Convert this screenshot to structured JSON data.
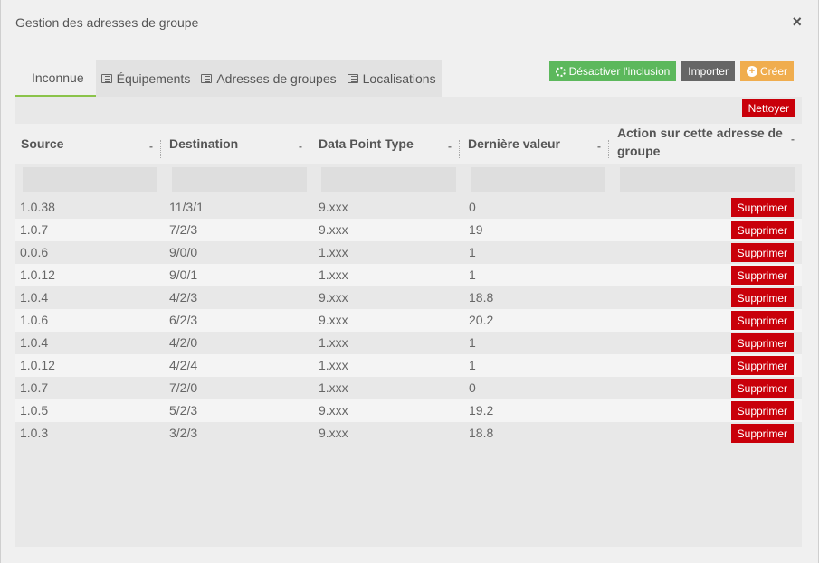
{
  "modal": {
    "title": "Gestion des adresses de groupe",
    "close_glyph": "×"
  },
  "tabs": [
    {
      "label": "Inconnue",
      "icon": null
    },
    {
      "label": "Équipements",
      "icon": "list-icon"
    },
    {
      "label": "Adresses de groupes",
      "icon": "list-icon"
    },
    {
      "label": "Localisations",
      "icon": "list-icon"
    }
  ],
  "toolbar": {
    "disable_inclusion": "Désactiver l'inclusion",
    "import": "Importer",
    "create": "Créer",
    "create_glyph": "+"
  },
  "colors": {
    "green": "#5cb85c",
    "gray": "#666666",
    "orange": "#f0ad4e",
    "red": "#c9000a",
    "active_tab_underline": "#8bc34a"
  },
  "table": {
    "clean_button": "Nettoyer",
    "columns": [
      {
        "label": "Source",
        "sort": "-"
      },
      {
        "label": "Destination",
        "sort": "-"
      },
      {
        "label": "Data Point Type",
        "sort": "-"
      },
      {
        "label": "Dernière valeur",
        "sort": "-"
      },
      {
        "label": "Action sur cette adresse de groupe",
        "sort": "-"
      }
    ],
    "delete_label": "Supprimer",
    "rows": [
      {
        "source": "1.0.38",
        "destination": "11/3/1",
        "dpt": "9.xxx",
        "value": "0"
      },
      {
        "source": "1.0.7",
        "destination": "7/2/3",
        "dpt": "9.xxx",
        "value": "19"
      },
      {
        "source": "0.0.6",
        "destination": "9/0/0",
        "dpt": "1.xxx",
        "value": "1"
      },
      {
        "source": "1.0.12",
        "destination": "9/0/1",
        "dpt": "1.xxx",
        "value": "1"
      },
      {
        "source": "1.0.4",
        "destination": "4/2/3",
        "dpt": "9.xxx",
        "value": "18.8"
      },
      {
        "source": "1.0.6",
        "destination": "6/2/3",
        "dpt": "9.xxx",
        "value": "20.2"
      },
      {
        "source": "1.0.4",
        "destination": "4/2/0",
        "dpt": "1.xxx",
        "value": "1"
      },
      {
        "source": "1.0.12",
        "destination": "4/2/4",
        "dpt": "1.xxx",
        "value": "1"
      },
      {
        "source": "1.0.7",
        "destination": "7/2/0",
        "dpt": "1.xxx",
        "value": "0"
      },
      {
        "source": "1.0.5",
        "destination": "5/2/3",
        "dpt": "9.xxx",
        "value": "19.2"
      },
      {
        "source": "1.0.3",
        "destination": "3/2/3",
        "dpt": "9.xxx",
        "value": "18.8"
      }
    ]
  }
}
